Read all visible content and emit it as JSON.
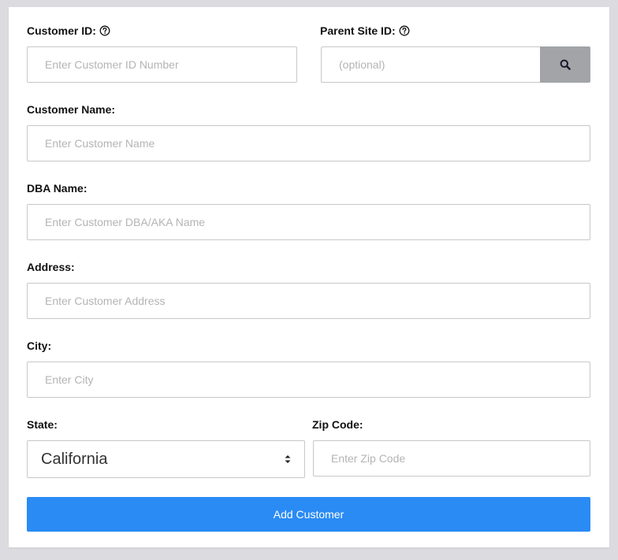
{
  "form": {
    "customer_id": {
      "label": "Customer ID:",
      "placeholder": "Enter Customer ID Number",
      "value": ""
    },
    "parent_site_id": {
      "label": "Parent Site ID:",
      "placeholder": "(optional)",
      "value": ""
    },
    "customer_name": {
      "label": "Customer Name:",
      "placeholder": "Enter Customer Name",
      "value": ""
    },
    "dba_name": {
      "label": "DBA Name:",
      "placeholder": "Enter Customer DBA/AKA Name",
      "value": ""
    },
    "address": {
      "label": "Address:",
      "placeholder": "Enter Customer Address",
      "value": ""
    },
    "city": {
      "label": "City:",
      "placeholder": "Enter City",
      "value": ""
    },
    "state": {
      "label": "State:",
      "selected": "California"
    },
    "zip_code": {
      "label": "Zip Code:",
      "placeholder": "Enter Zip Code",
      "value": ""
    },
    "submit_label": "Add Customer"
  },
  "icons": {
    "help": "question-circle-icon",
    "search": "search-icon",
    "select": "sort-arrows-icon"
  },
  "colors": {
    "primary_button": "#2a8bf5",
    "search_button": "#a2a4a7",
    "background": "#dcdce0"
  }
}
